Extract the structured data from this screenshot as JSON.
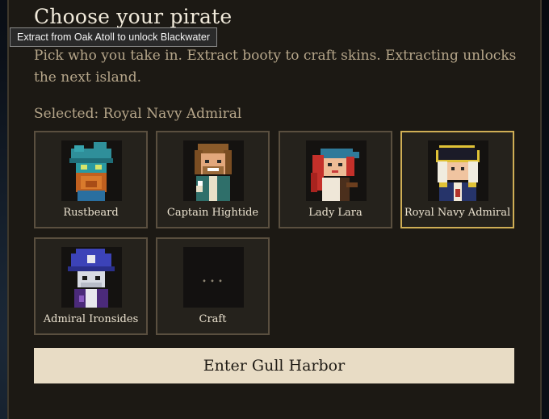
{
  "screen": {
    "title": "Choose your pirate",
    "tooltip": "Extract from Oak Atoll to unlock Blackwater",
    "description": "Pick who you take in. Extract booty to craft skins. Extracting unlocks the next island.",
    "selected_text": "Selected: Royal Navy Admiral",
    "enter_button": "Enter Gull Harbor"
  },
  "characters": [
    {
      "name": "Rustbeard",
      "selected": false,
      "icon": "rustbeard-portrait"
    },
    {
      "name": "Captain Hightide",
      "selected": false,
      "icon": "captain-hightide-portrait"
    },
    {
      "name": "Lady Lara",
      "selected": false,
      "icon": "lady-lara-portrait"
    },
    {
      "name": "Royal Navy Admiral",
      "selected": true,
      "icon": "royal-navy-admiral-portrait"
    },
    {
      "name": "Admiral Ironsides",
      "selected": false,
      "icon": "admiral-ironsides-portrait"
    },
    {
      "name": "Craft",
      "selected": false,
      "icon": "ellipsis-icon",
      "glyph": "..."
    }
  ],
  "colors": {
    "panel": "#1c1914",
    "card_border": "#5a4f3f",
    "selected_border": "#cfae55",
    "button_bg": "#e8dcc5",
    "muted_text": "#b6a68a"
  }
}
